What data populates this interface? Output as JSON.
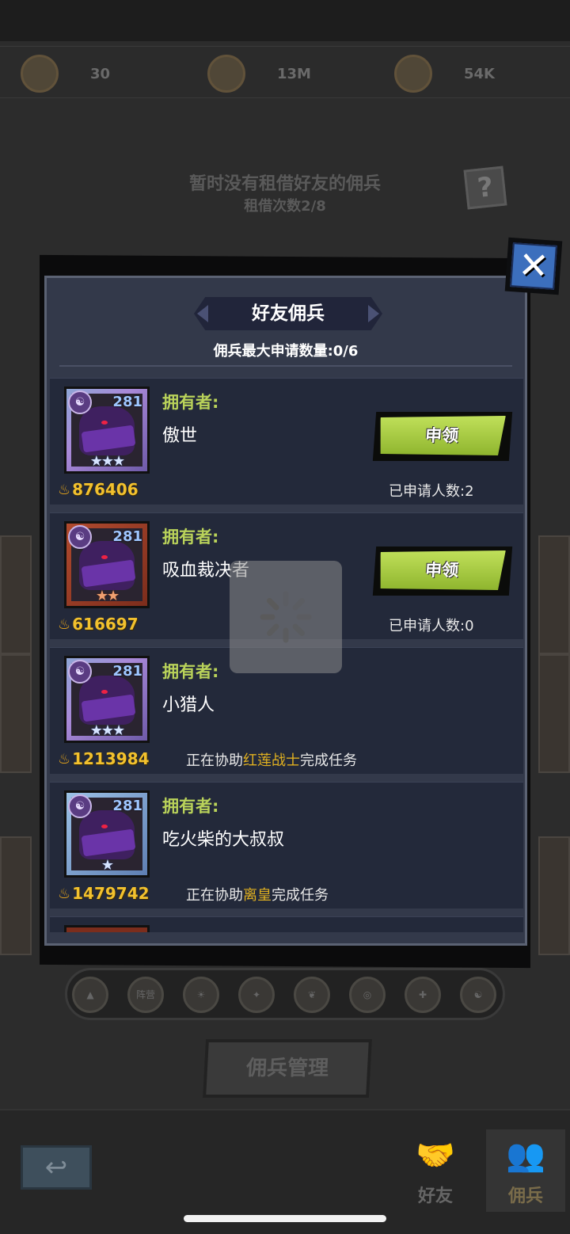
{
  "resources": [
    {
      "icon": "heart-icon",
      "value": "30"
    },
    {
      "icon": "coin-icon",
      "value": "13M"
    },
    {
      "icon": "gear-coin-icon",
      "value": "54K"
    }
  ],
  "background": {
    "notice": "暂时没有租借好友的佣兵",
    "rent_count": "租借次数2/8",
    "help_icon": "?",
    "filter_center_label": "阵营",
    "manage_button": "佣兵管理",
    "tabs": [
      {
        "label": "好友",
        "icon": "handshake-icon"
      },
      {
        "label": "佣兵",
        "icon": "group-icon"
      }
    ]
  },
  "modal": {
    "title": "好友佣兵",
    "subtitle": "佣兵最大申请数量:0/6",
    "owner_label": "拥有者:",
    "close": "✕",
    "rows": [
      {
        "level": "281",
        "stars": "★★★",
        "power": "876406",
        "owner": "傲世",
        "button": "申领",
        "applicants": "已申请人数:2"
      },
      {
        "level": "281",
        "stars": "★★",
        "power": "616697",
        "owner": "吸血裁决者",
        "button": "申领",
        "applicants": "已申请人数:0"
      },
      {
        "level": "281",
        "stars": "★★★",
        "power": "1213984",
        "owner": "小猎人",
        "assist_prefix": "正在协助",
        "assist_target": "红莲战士",
        "assist_suffix": "完成任务"
      },
      {
        "level": "281",
        "stars": "★",
        "power": "1479742",
        "owner": "吃火柴的大叔叔",
        "assist_prefix": "正在协助",
        "assist_target": "离皇",
        "assist_suffix": "完成任务"
      }
    ]
  },
  "colors": {
    "owner_label": "#b9d25a",
    "power": "#f2c12e",
    "assist_highlight": "#e0b020",
    "apply_button": "#a6cc3e"
  }
}
